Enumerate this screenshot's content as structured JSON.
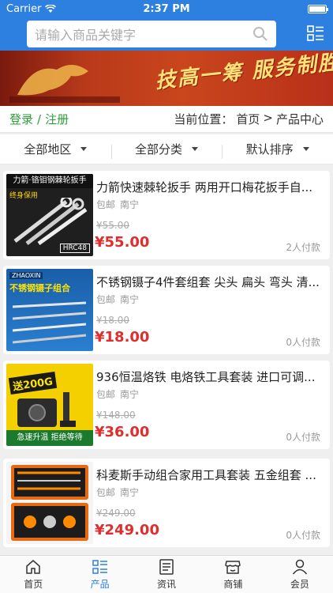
{
  "status": {
    "carrier": "Carrier",
    "time": "2:37 PM"
  },
  "search": {
    "placeholder": "请输入商品关键字"
  },
  "banner": {
    "slogan": "技高一筹 服务制胜"
  },
  "location": {
    "login": "登录",
    "separator": "/",
    "register": "注册",
    "current_label": "当前位置：",
    "home": "首页",
    "arrow": ">",
    "page": "产品中心"
  },
  "filters": [
    {
      "label": "全部地区"
    },
    {
      "label": "全部分类"
    },
    {
      "label": "默认排序"
    }
  ],
  "products": [
    {
      "title": "力箭快速棘轮扳手 两用开口梅花扳手自...",
      "shipping": "包邮",
      "city": "南宁",
      "old_price": "¥55.00",
      "price": "¥55.00",
      "sold": "2人付款",
      "thumb_text": "力箭·铬钼钢棘轮扳手",
      "thumb_sub": "HRC48",
      "thumb_tag": "终身保用"
    },
    {
      "title": "不锈钢镊子4件套组套 尖头 扁头 弯头 清...",
      "shipping": "包邮",
      "city": "南宁",
      "old_price": "¥18.00",
      "price": "¥18.00",
      "sold": "0人付款",
      "thumb_text": "不锈钢镊子组合",
      "thumb_sub": "",
      "thumb_tag": "ZHAOXIN"
    },
    {
      "title": "936恒温烙铁 电烙铁工具套装 进口可调...",
      "shipping": "包邮",
      "city": "南宁",
      "old_price": "¥148.00",
      "price": "¥36.00",
      "sold": "0人付款",
      "thumb_text": "送200G",
      "thumb_sub": "急速升温 拒绝等待",
      "thumb_tag": ""
    },
    {
      "title": "科麦斯手动组合家用工具套装 五金组套 ...",
      "shipping": "包邮",
      "city": "南宁",
      "old_price": "¥249.00",
      "price": "¥249.00",
      "sold": "0人付款",
      "thumb_text": "",
      "thumb_sub": "",
      "thumb_tag": ""
    }
  ],
  "tabbar": [
    {
      "label": "首页",
      "icon": "home-icon"
    },
    {
      "label": "产品",
      "icon": "product-list-icon"
    },
    {
      "label": "资讯",
      "icon": "news-icon"
    },
    {
      "label": "商铺",
      "icon": "store-icon"
    },
    {
      "label": "会员",
      "icon": "user-icon"
    }
  ],
  "colors": {
    "brand": "#2e80e0",
    "price": "#e02d2d",
    "link": "#2d9e3a"
  }
}
